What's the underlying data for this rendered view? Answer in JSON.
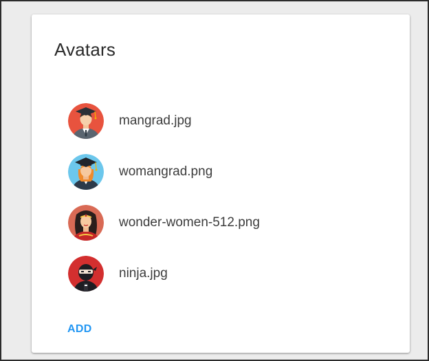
{
  "card": {
    "title": "Avatars",
    "add_label": "ADD"
  },
  "avatars": [
    {
      "file": "mangrad.jpg",
      "icon": "graduate-man-icon"
    },
    {
      "file": "womangrad.png",
      "icon": "graduate-woman-icon"
    },
    {
      "file": "wonder-women-512.png",
      "icon": "wonder-woman-icon"
    },
    {
      "file": "ninja.jpg",
      "icon": "ninja-icon"
    }
  ],
  "colors": {
    "accent": "#2196f3",
    "background": "#ececec",
    "card": "#ffffff"
  }
}
